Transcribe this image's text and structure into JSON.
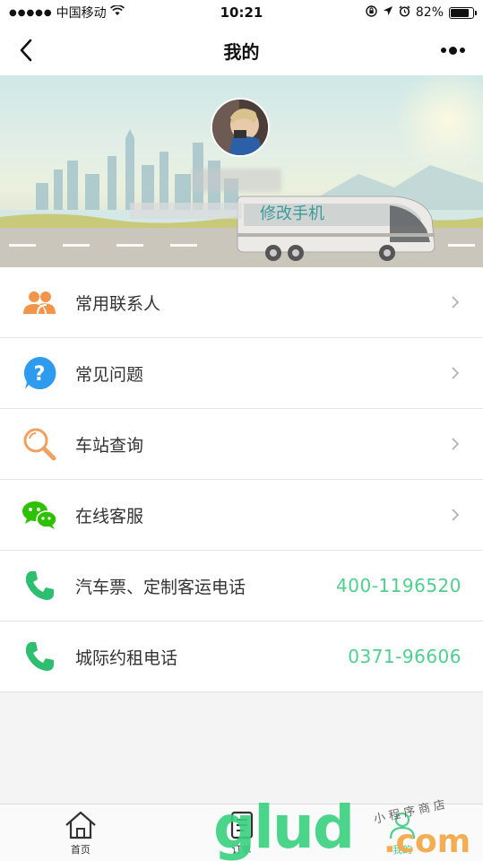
{
  "status_bar": {
    "carrier": "中国移动",
    "time": "10:21",
    "battery": "82%",
    "battery_level": 0.82
  },
  "nav": {
    "title": "我的"
  },
  "profile": {
    "edit_phone_label": "修改手机"
  },
  "menu": [
    {
      "label": "常用联系人",
      "icon": "contacts-icon"
    },
    {
      "label": "常见问题",
      "icon": "question-icon"
    },
    {
      "label": "车站查询",
      "icon": "search-icon"
    },
    {
      "label": "在线客服",
      "icon": "wechat-icon"
    },
    {
      "label": "汽车票、定制客运电话",
      "phone": "400-1196520",
      "icon": "phone-icon"
    },
    {
      "label": "城际约租电话",
      "phone": "0371-96606",
      "icon": "phone-icon"
    }
  ],
  "tabs": [
    {
      "label": "首页",
      "icon": "home-icon"
    },
    {
      "label": "订单",
      "icon": "order-icon"
    },
    {
      "label": "我的",
      "icon": "profile-icon"
    }
  ],
  "watermark": {
    "main": "glud",
    "suffix": ".com",
    "small": "小程序商店"
  },
  "colors": {
    "accent_green": "#4fcf8e",
    "contacts_orange": "#f0954a",
    "question_blue": "#2f9bef",
    "wechat_green": "#2dc100"
  }
}
